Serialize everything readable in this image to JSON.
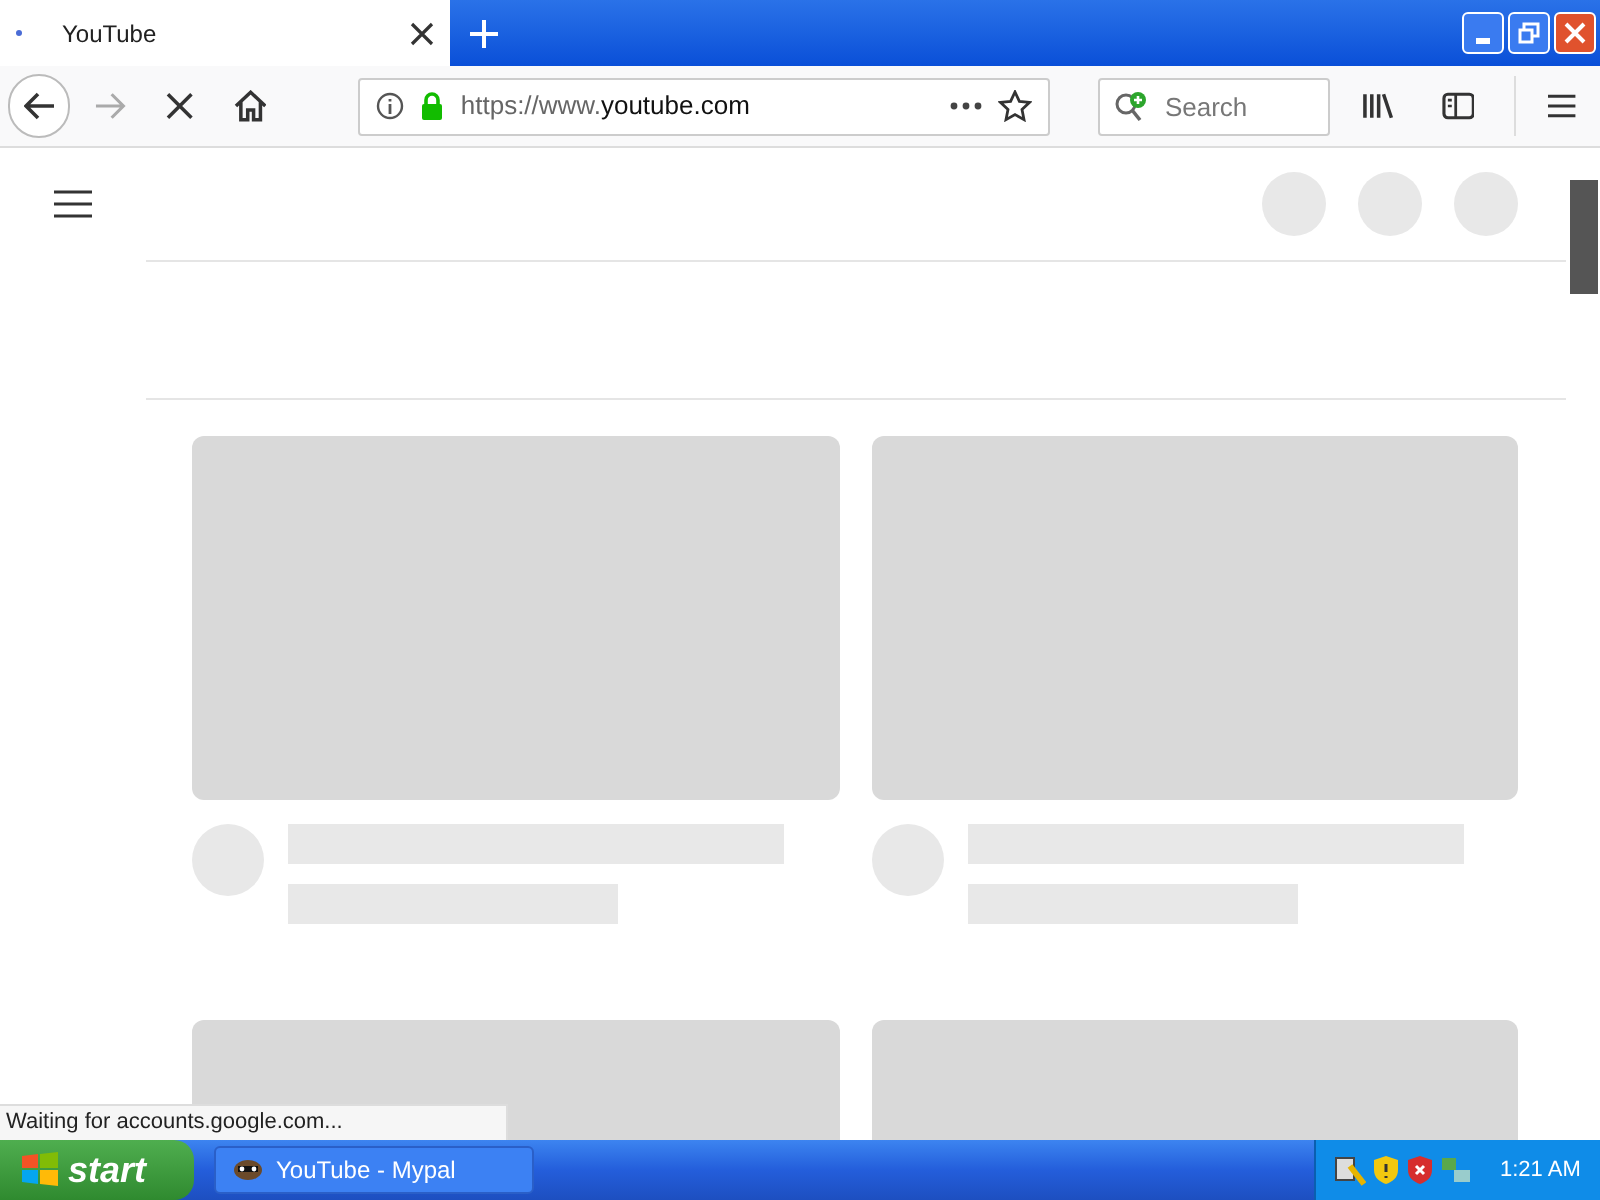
{
  "browser": {
    "tab": {
      "title": "YouTube",
      "loading": true,
      "selected": true
    },
    "address": {
      "url_prefix": "https://www.",
      "url_domain": "youtube.com",
      "secure": true
    },
    "search": {
      "placeholder": "Search"
    },
    "status": "Waiting for accounts.google.com..."
  },
  "taskbar": {
    "start": "start",
    "tasks": [
      {
        "label": "YouTube - Mypal"
      }
    ],
    "clock": "1:21 AM"
  }
}
